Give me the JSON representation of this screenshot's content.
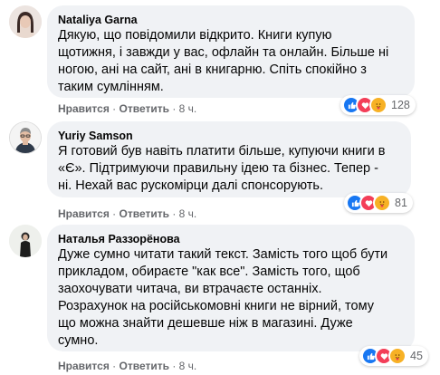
{
  "comments": [
    {
      "author": "Nataliya Garna",
      "lines": [
        "Дякую, що повідомили відкрито. Книги купую",
        "щотижня, і завжди у вас, офлайн та онлайн. Більше ні",
        "ногою, ані на сайт, ані в книгарню. Спіть спокійно з",
        "таким сумлінням."
      ],
      "like_label": "Нравится",
      "reply_label": "Ответить",
      "time": "8 ч.",
      "reaction_count": "128",
      "reactions": [
        "like-icon",
        "love-icon",
        "care-icon"
      ]
    },
    {
      "author": "Yuriy Samson",
      "lines": [
        "Я готовий був навіть платити більше, купуючи книги в",
        "«Є». Підтримуючи правильну ідею та бізнес. Тепер -",
        "ні. Нехай вас рускомірци далі спонсорують."
      ],
      "like_label": "Нравится",
      "reply_label": "Ответить",
      "time": "8 ч.",
      "reaction_count": "81",
      "reactions": [
        "like-icon",
        "love-icon",
        "care-icon"
      ]
    },
    {
      "author": "Наталья Раззорёнова",
      "lines": [
        "Дуже сумно читати такий текст. Замість того щоб бути",
        "прикладом, обираєте \"как все\". Замість того, щоб",
        "заохочувати читача, ви втрачаєте останніх.",
        "Розрахунок на російськомовні книги не вірний, тому",
        "що можна знайти дешевше ніж в магазині. Дуже",
        "сумно."
      ],
      "like_label": "Нравится",
      "reply_label": "Ответить",
      "time": "8 ч.",
      "reaction_count": "45",
      "reactions": [
        "like-icon",
        "love-icon",
        "care-icon"
      ]
    }
  ],
  "separator": "·",
  "colors": {
    "like": "#1877f2",
    "love": "#f33e58",
    "care": "#f7b125",
    "bubble": "#f0f2f5",
    "meta": "#65676b"
  }
}
